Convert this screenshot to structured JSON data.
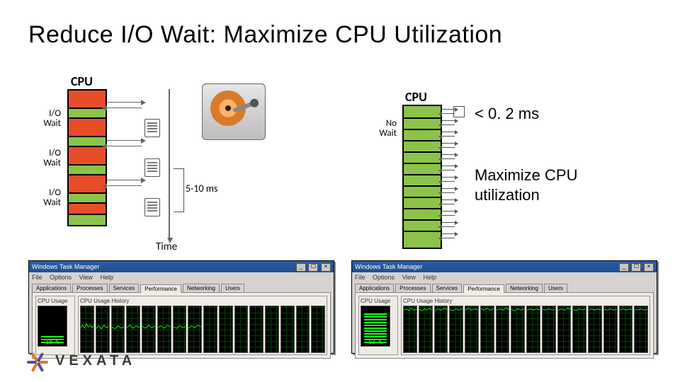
{
  "title": "Reduce I/O Wait:  Maximize CPU Utilization",
  "left_diagram": {
    "cpu_label": "CPU",
    "io_wait_label": "I/O\nWait",
    "bracket_label": "5-10 ms",
    "time_label": "Time"
  },
  "right_diagram": {
    "cpu_label": "CPU",
    "no_wait_label": "No\nWait",
    "latency_annotation": "< 0. 2 ms",
    "benefit_annotation": "Maximize CPU utilization"
  },
  "taskmgr": {
    "window_title": "Windows Task Manager",
    "menus": [
      "File",
      "Options",
      "View",
      "Help"
    ],
    "tabs": [
      "Applications",
      "Processes",
      "Services",
      "Performance",
      "Networking",
      "Users"
    ],
    "active_tab": "Performance",
    "group_cpu_usage": "CPU Usage",
    "group_cpu_history": "CPU Usage History",
    "left_pct": "18 %",
    "right_pct": "93 %",
    "btn_min": "_",
    "btn_max": "☐",
    "btn_close": "×"
  },
  "brand": "VEXATA"
}
